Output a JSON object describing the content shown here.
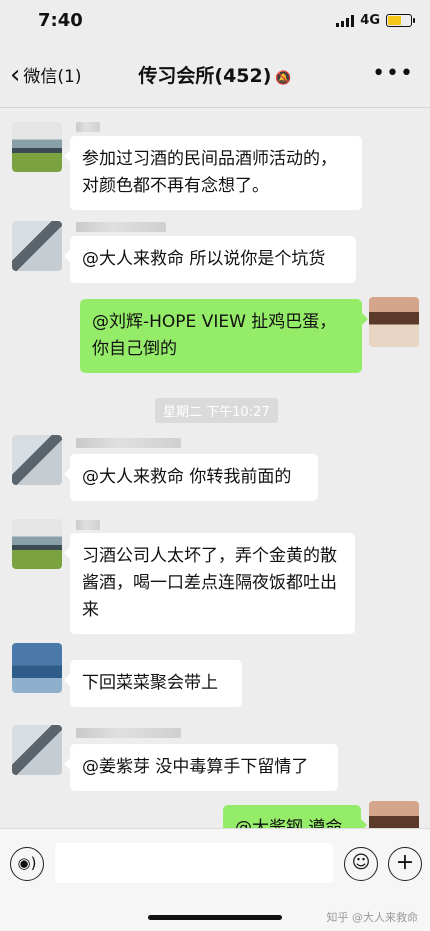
{
  "status_bar": {
    "time": "7:40",
    "network": "4G"
  },
  "nav": {
    "back_label": "微信(1)",
    "title": "传习会所(452)"
  },
  "timestamp": "星期二 下午10:27",
  "messages": [
    {
      "side": "in",
      "text": "参加过习酒的民间品酒师活动的，对颜色都不再有念想了。"
    },
    {
      "side": "in",
      "text": "@大人来救命 所以说你是个坑货"
    },
    {
      "side": "out",
      "text": "@刘辉-HOPE VIEW 扯鸡巴蛋，你自己倒的"
    },
    {
      "side": "in",
      "text": "@大人来救命 你转我前面的"
    },
    {
      "side": "in",
      "text": "习酒公司人太坏了，弄个金黄的散酱酒，喝一口差点连隔夜饭都吐出来"
    },
    {
      "side": "in",
      "text": "下回菜菜聚会带上"
    },
    {
      "side": "in",
      "text": "@姜紫芽 没中毒算手下留情了"
    },
    {
      "side": "out",
      "text": "@大酱钢 遵命"
    }
  ],
  "input": {
    "value": "",
    "placeholder": ""
  },
  "watermark": "知乎 @大人来救命",
  "icons": [
    "back-chevron-icon",
    "mute-bell-icon",
    "more-dots-icon",
    "voice-icon",
    "emoji-icon",
    "plus-icon"
  ]
}
